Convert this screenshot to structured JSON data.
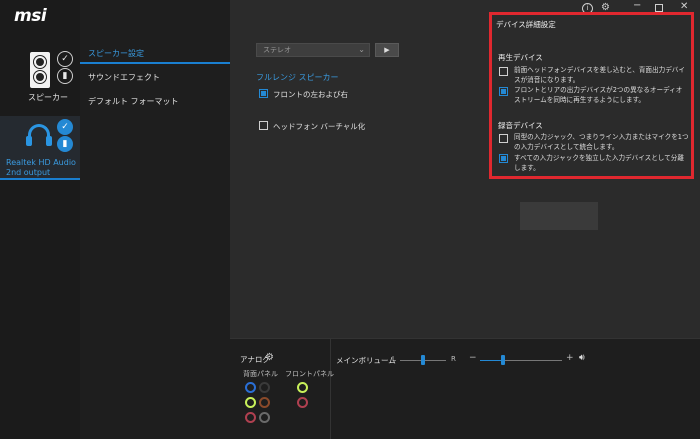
{
  "app": {
    "logo": "msi"
  },
  "devices": [
    {
      "label": "スピーカー"
    },
    {
      "label": "Realtek HD Audio 2nd output"
    }
  ],
  "menu": {
    "items": [
      {
        "label": "スピーカー設定",
        "active": true
      },
      {
        "label": "サウンドエフェクト",
        "active": false
      },
      {
        "label": "デフォルト フォーマット",
        "active": false
      }
    ]
  },
  "speaker_config": {
    "dropdown_value": "ステレオ",
    "fullrange_label": "フルレンジ スピーカー",
    "fullrange_option": "フロントの左および右",
    "fullrange_checked": true,
    "headphone_option": "ヘッドフォン バーチャル化",
    "headphone_checked": false
  },
  "advanced": {
    "title": "デバイス詳細設定",
    "playback_title": "再生デバイス",
    "playback_options": [
      {
        "text": "前面ヘッドフォンデバイスを差し込むと、背面出力デバイスが消音になります。",
        "checked": false
      },
      {
        "text": "フロントとリアの出力デバイスが2つの異なるオーディオ ストリームを同時に再生するようにします。",
        "checked": true
      }
    ],
    "record_title": "録音デバイス",
    "record_options": [
      {
        "text": "同型の入力ジャック、つまりライン入力またはマイクを1つの入力デバイスとして統合します。",
        "checked": false
      },
      {
        "text": "すべての入力ジャックを独立した入力デバイスとして分離します。",
        "checked": true
      }
    ]
  },
  "bottom": {
    "analog_label": "アナログ",
    "back_panel_label": "背面パネル",
    "front_panel_label": "フロントパネル",
    "main_volume_label": "メインボリューム",
    "balance_left": "L",
    "balance_right": "R",
    "balance_level": 0.5,
    "volume_minus": "−",
    "volume_plus": "+",
    "volume_level": 0.28
  },
  "colors": {
    "accent": "#2489d4",
    "highlight_border": "#e0282f",
    "jack_blue": "#2a6fd6",
    "jack_lime": "#c8f05a",
    "jack_brown": "#8a4a2a",
    "jack_gray": "#6a6a6a",
    "jack_pink": "#b04050"
  }
}
